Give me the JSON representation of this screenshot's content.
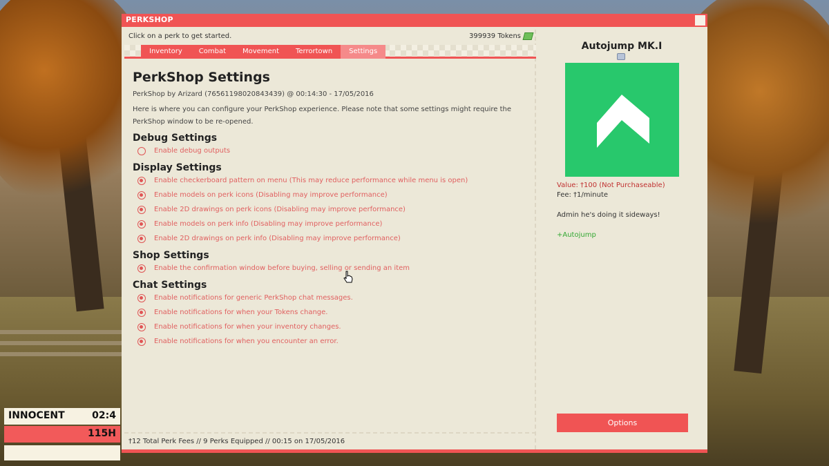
{
  "hud": {
    "role": "INNOCENT",
    "time": "02:4",
    "health": "115H"
  },
  "window": {
    "title": "PERKSHOP"
  },
  "topbar": {
    "hint": "Click on a perk to get started.",
    "tokens": "399939 Tokens"
  },
  "tabs": [
    {
      "label": "Inventory"
    },
    {
      "label": "Combat"
    },
    {
      "label": "Movement"
    },
    {
      "label": "Terrortown"
    },
    {
      "label": "Settings",
      "active": true
    }
  ],
  "settings": {
    "title": "PerkShop Settings",
    "byline": "PerkShop by Arizard (76561198020843439) @ 00:14:30 - 17/05/2016",
    "description": "Here is where you can configure your PerkShop experience. Please note that some settings might require the PerkShop window to be re-opened.",
    "sections": [
      {
        "title": "Debug Settings",
        "options": [
          {
            "label": "Enable debug outputs",
            "checked": false
          }
        ]
      },
      {
        "title": "Display Settings",
        "options": [
          {
            "label": "Enable checkerboard pattern on menu (This may reduce performance while menu is open)",
            "checked": true
          },
          {
            "label": "Enable models on perk icons (Disabling may improve performance)",
            "checked": true
          },
          {
            "label": "Enable 2D drawings on perk icons (Disabling may improve performance)",
            "checked": true
          },
          {
            "label": "Enable models on perk info (Disabling may improve performance)",
            "checked": true
          },
          {
            "label": "Enable 2D drawings on perk info (Disabling may improve performance)",
            "checked": true
          }
        ]
      },
      {
        "title": "Shop Settings",
        "options": [
          {
            "label": "Enable the confirmation window before buying, selling or sending an item",
            "checked": true
          }
        ]
      },
      {
        "title": "Chat Settings",
        "options": [
          {
            "label": "Enable notifications for generic PerkShop chat messages.",
            "checked": true
          },
          {
            "label": "Enable notifications for when your Tokens change.",
            "checked": true
          },
          {
            "label": "Enable notifications for when your inventory changes.",
            "checked": true
          },
          {
            "label": "Enable notifications for when you encounter an error.",
            "checked": true
          }
        ]
      }
    ]
  },
  "footer": {
    "text": "†12 Total Perk Fees // 9 Perks Equipped // 00:15 on 17/05/2016"
  },
  "perk": {
    "name": "Autojump MK.I",
    "image_color": "#28c86c",
    "value": "Value: †100 (Not Purchaseable)",
    "fee": "Fee: †1/minute",
    "description": "Admin he's doing it sideways!",
    "effect": "+Autojump",
    "options_label": "Options"
  },
  "colors": {
    "accent": "#f05454",
    "option_text": "#e06060",
    "panel": "#ece8d8",
    "effect": "#33a833"
  }
}
